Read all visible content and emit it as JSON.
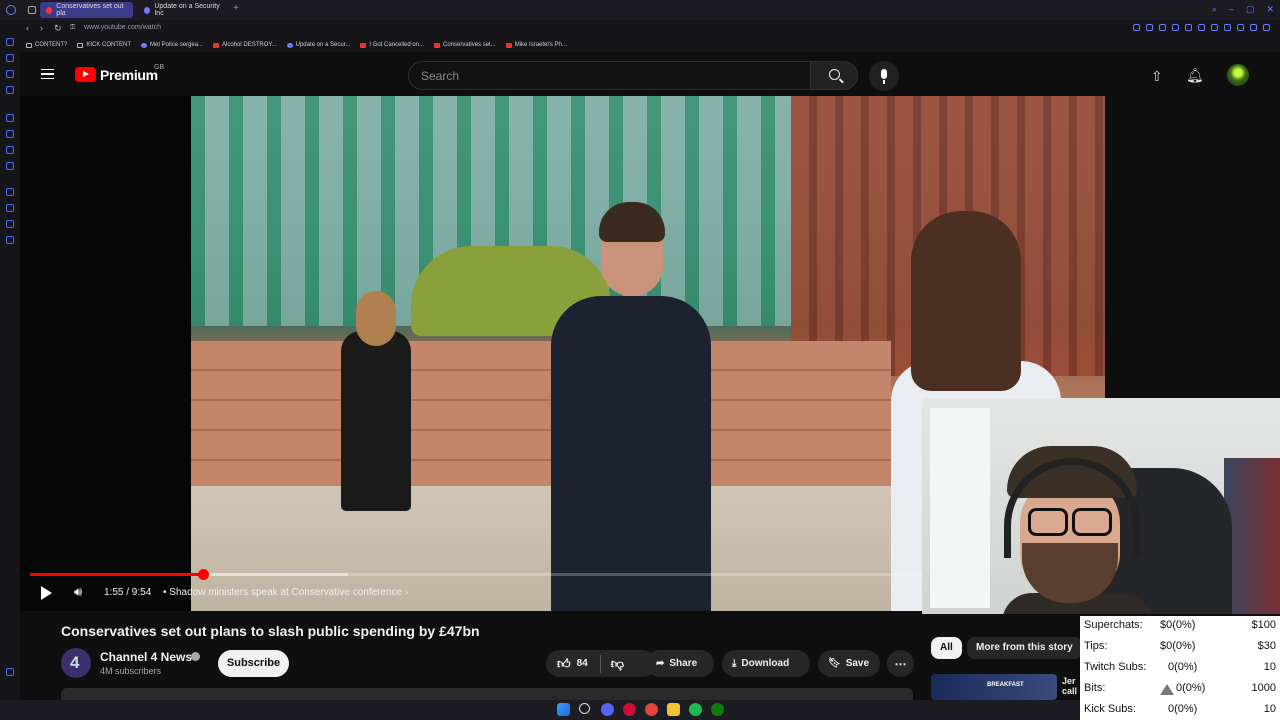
{
  "browser": {
    "tabs": [
      {
        "label": "Conservatives set out pla",
        "active": true,
        "favicon": "youtube-icon"
      },
      {
        "label": "Update on a Security Inc",
        "active": false,
        "favicon": "globe-icon"
      }
    ],
    "url": "www.youtube.com/watch",
    "bookmarks": [
      {
        "label": "CONTENT?",
        "icon": "folder-icon"
      },
      {
        "label": "KICK CONTENT",
        "icon": "folder-icon"
      },
      {
        "label": "Met Police sergea...",
        "icon": "globe-icon"
      },
      {
        "label": "Alcohol DESTROY...",
        "icon": "youtube-icon"
      },
      {
        "label": "Update on a Secur...",
        "icon": "globe-icon"
      },
      {
        "label": "I Got Cancelled on...",
        "icon": "youtube-icon"
      },
      {
        "label": "Conservatives set...",
        "icon": "youtube-icon"
      },
      {
        "label": "Mike Israetel's Ph...",
        "icon": "youtube-icon"
      }
    ]
  },
  "header": {
    "brand": "Premium",
    "region": "GB",
    "search_placeholder": "Search"
  },
  "player": {
    "current_time": "1:55",
    "duration": "9:54",
    "time_text": "1:55 / 9:54",
    "chapter": "Shadow ministers speak at Conservative conference",
    "played_fraction": 0.194,
    "buffered_fraction": 0.357
  },
  "video": {
    "title": "Conservatives set out plans to slash public spending by £47bn",
    "channel_name": "Channel 4 News",
    "subscribers": "4M subscribers",
    "subscribe_label": "Subscribe",
    "like_count": "84",
    "share_label": "Share",
    "download_label": "Download",
    "save_label": "Save"
  },
  "related": {
    "chips": [
      "All",
      "More from this story"
    ],
    "first_item_title": "Jer",
    "first_item_subtitle": "call",
    "first_item_thumb_label": "BREAKFAST"
  },
  "stats": [
    {
      "label": "Superchats:",
      "value": "$0(0%)",
      "goal": "$100"
    },
    {
      "label": "Tips:",
      "value": "$0(0%)",
      "goal": "$30"
    },
    {
      "label": "Twitch Subs:",
      "value": "0(0%)",
      "goal": "10"
    },
    {
      "label": "Bits:",
      "value": "0(0%)",
      "goal": "1000"
    },
    {
      "label": "Kick Subs:",
      "value": "0(0%)",
      "goal": "10"
    }
  ],
  "colors": {
    "accent": "#ff0000",
    "background": "#0f0f0f",
    "tab_active": "#3b3b8a"
  }
}
